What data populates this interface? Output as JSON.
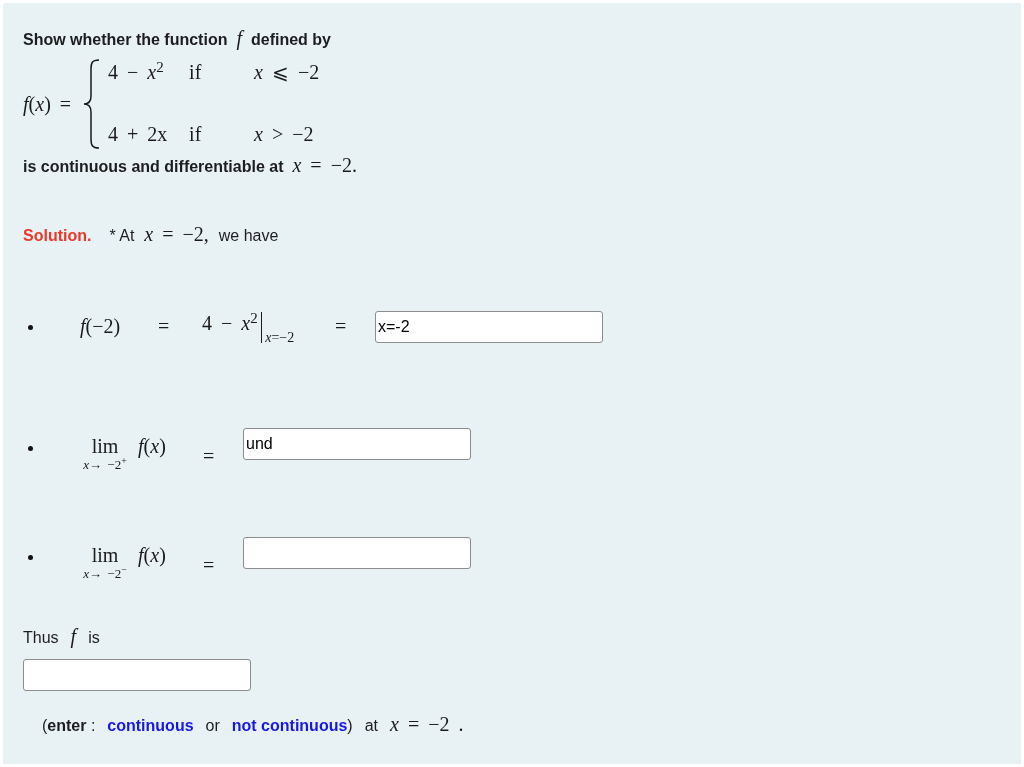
{
  "question": {
    "prompt": [
      {
        "kind": "strong",
        "text": "Show whether the function"
      },
      {
        "kind": "variable",
        "text": "f"
      },
      {
        "kind": "strong",
        "text": "defined by"
      }
    ],
    "definition": {
      "lhs": "*f*(*x*) =",
      "cases": [
        {
          "expression": "4 − *x*$^{2}$",
          "keyword": "if",
          "condition": "*x* ⩽ −2"
        },
        {
          "expression": "4 + 2x",
          "keyword": "if",
          "condition": "*x* > −2"
        }
      ]
    },
    "task": [
      {
        "kind": "strong",
        "text": "is continuous and differentiable at"
      },
      {
        "kind": "math",
        "text": "*x* = −2."
      }
    ]
  },
  "solution": {
    "intro": [
      {
        "kind": "label",
        "text": "Solution."
      },
      {
        "kind": "text",
        "text": "* At"
      },
      {
        "kind": "math",
        "text": "*x* = −2,"
      },
      {
        "kind": "text",
        "text": "we have"
      }
    ],
    "steps": [
      {
        "kind": "evaluation",
        "lhs": "*f*(−2)",
        "equals": "=",
        "expression": "4 − *x*$^{2}$",
        "at": "*x*=−2",
        "equals_2": "=",
        "answer": "x=-2"
      },
      {
        "kind": "limit",
        "operator": "lim",
        "approach": "*x*→ −2$^{+}$",
        "function": "*f*(*x*)",
        "equals": "=",
        "answer": "und"
      },
      {
        "kind": "limit",
        "operator": "lim",
        "approach": "*x*→ −2$^{−}$",
        "function": "*f*(*x*)",
        "equals": "="
      }
    ],
    "conclusion": {
      "lead": [
        {
          "kind": "text",
          "text": "Thus"
        },
        {
          "kind": "variable",
          "text": "f"
        },
        {
          "kind": "text",
          "text": "is"
        }
      ],
      "hint": [
        {
          "kind": "mixed",
          "text": "(**enter** :"
        },
        {
          "kind": "keyword",
          "text": "continuous"
        },
        {
          "kind": "text",
          "text": "or"
        },
        {
          "kind": "keyword",
          "text": "not continuous"
        },
        {
          "kind": "punctuation",
          "text": ")"
        },
        {
          "kind": "text",
          "text": "at"
        },
        {
          "kind": "math",
          "text": "*x* = −2 ."
        }
      ]
    }
  }
}
